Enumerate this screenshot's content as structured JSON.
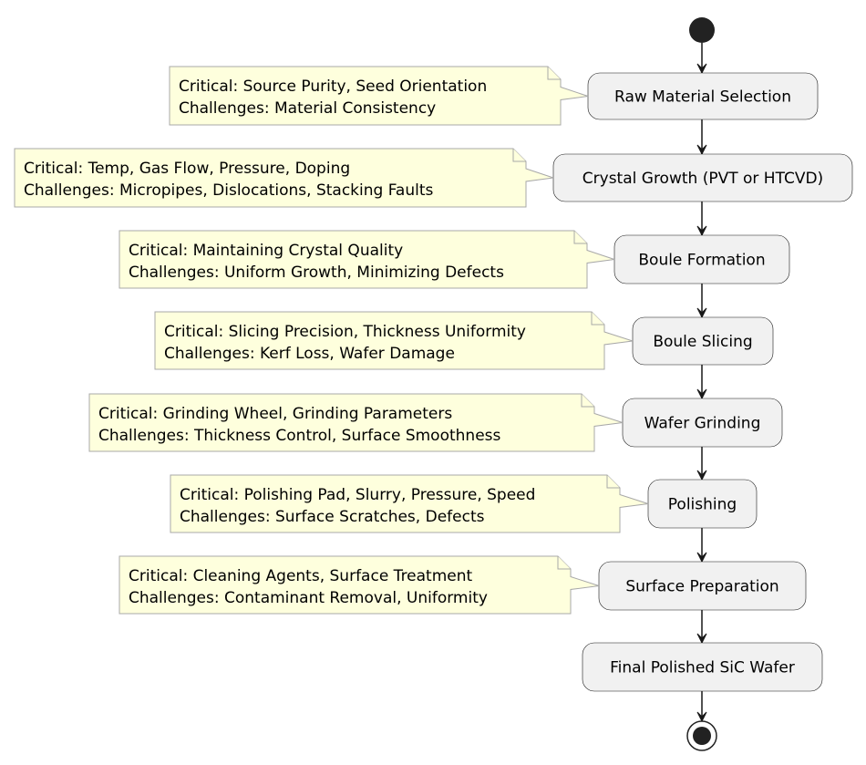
{
  "diagram": {
    "type": "activity",
    "colors": {
      "activity_fill": "#F1F1F1",
      "activity_border": "#181818",
      "note_fill": "#FEFFDD",
      "note_border": "#A8A8A8",
      "arrow": "#181818",
      "start_end": "#222222"
    },
    "activities": [
      {
        "label": "Raw Material Selection",
        "note": [
          "Critical: Source Purity, Seed Orientation",
          "Challenges: Material Consistency"
        ]
      },
      {
        "label": "Crystal Growth (PVT or HTCVD)",
        "note": [
          "Critical: Temp, Gas Flow, Pressure, Doping",
          "Challenges: Micropipes, Dislocations, Stacking Faults"
        ]
      },
      {
        "label": "Boule Formation",
        "note": [
          "Critical: Maintaining Crystal Quality",
          "Challenges: Uniform Growth, Minimizing Defects"
        ]
      },
      {
        "label": "Boule Slicing",
        "note": [
          "Critical: Slicing Precision, Thickness Uniformity",
          "Challenges: Kerf Loss, Wafer Damage"
        ]
      },
      {
        "label": "Wafer Grinding",
        "note": [
          "Critical: Grinding Wheel, Grinding Parameters",
          "Challenges: Thickness Control, Surface Smoothness"
        ]
      },
      {
        "label": "Polishing",
        "note": [
          "Critical: Polishing Pad, Slurry, Pressure, Speed",
          "Challenges: Surface Scratches, Defects"
        ]
      },
      {
        "label": "Surface Preparation",
        "note": [
          "Critical: Cleaning Agents, Surface Treatment",
          "Challenges: Contaminant Removal, Uniformity"
        ]
      },
      {
        "label": "Final Polished SiC Wafer",
        "note": null
      }
    ]
  }
}
